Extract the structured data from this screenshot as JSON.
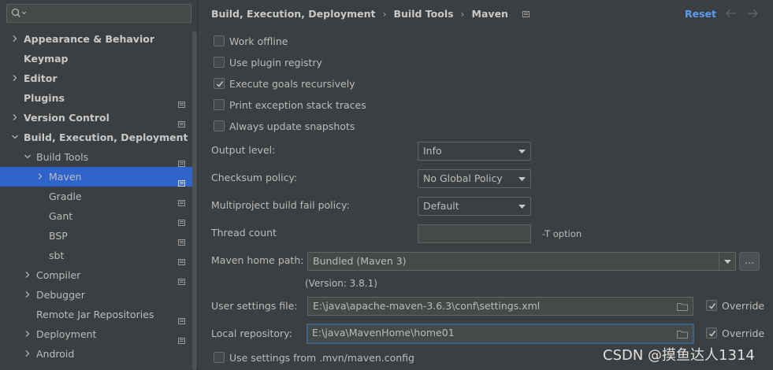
{
  "search": {
    "placeholder": ""
  },
  "sidebar": {
    "items": [
      {
        "label": "Appearance & Behavior",
        "bold": true,
        "chevron": "right",
        "project_icon": false
      },
      {
        "label": "Keymap",
        "bold": true,
        "chevron": "none",
        "project_icon": false
      },
      {
        "label": "Editor",
        "bold": true,
        "chevron": "right",
        "project_icon": false
      },
      {
        "label": "Plugins",
        "bold": true,
        "chevron": "none",
        "project_icon": true
      },
      {
        "label": "Version Control",
        "bold": true,
        "chevron": "right",
        "project_icon": true
      },
      {
        "label": "Build, Execution, Deployment",
        "bold": true,
        "chevron": "down",
        "project_icon": false
      },
      {
        "label": "Build Tools",
        "bold": false,
        "chevron": "down",
        "project_icon": true
      },
      {
        "label": "Maven",
        "bold": false,
        "chevron": "right",
        "project_icon": true,
        "selected": true
      },
      {
        "label": "Gradle",
        "bold": false,
        "chevron": "none",
        "project_icon": true
      },
      {
        "label": "Gant",
        "bold": false,
        "chevron": "none",
        "project_icon": true
      },
      {
        "label": "BSP",
        "bold": false,
        "chevron": "none",
        "project_icon": true
      },
      {
        "label": "sbt",
        "bold": false,
        "chevron": "none",
        "project_icon": true
      },
      {
        "label": "Compiler",
        "bold": false,
        "chevron": "right",
        "project_icon": true
      },
      {
        "label": "Debugger",
        "bold": false,
        "chevron": "right",
        "project_icon": false
      },
      {
        "label": "Remote Jar Repositories",
        "bold": false,
        "chevron": "none",
        "project_icon": true
      },
      {
        "label": "Deployment",
        "bold": false,
        "chevron": "right",
        "project_icon": true
      },
      {
        "label": "Android",
        "bold": false,
        "chevron": "right",
        "project_icon": false
      }
    ]
  },
  "header": {
    "breadcrumb": [
      "Build, Execution, Deployment",
      "Build Tools",
      "Maven"
    ],
    "separator": "›",
    "reset_label": "Reset"
  },
  "checkboxes": [
    {
      "label": "Work offline",
      "checked": false
    },
    {
      "label": "Use plugin registry",
      "checked": false
    },
    {
      "label": "Execute goals recursively",
      "checked": true
    },
    {
      "label": "Print exception stack traces",
      "checked": false
    },
    {
      "label": "Always update snapshots",
      "checked": false
    }
  ],
  "form": {
    "output_level": {
      "label": "Output level:",
      "value": "Info"
    },
    "checksum_policy": {
      "label": "Checksum policy:",
      "value": "No Global Policy"
    },
    "fail_policy": {
      "label": "Multiproject build fail policy:",
      "value": "Default"
    },
    "thread_count": {
      "label": "Thread count",
      "value": "",
      "hint": "-T option"
    },
    "maven_home": {
      "label": "Maven home path:",
      "value": "Bundled (Maven 3)",
      "browse_label": "...",
      "version": "(Version: 3.8.1)"
    },
    "user_settings": {
      "label": "User settings file:",
      "value": "E:\\java\\apache-maven-3.6.3\\conf\\settings.xml",
      "override_label": "Override",
      "override_checked": true
    },
    "local_repo": {
      "label": "Local repository:",
      "value": "E:\\java\\MavenHome\\home01",
      "override_label": "Override",
      "override_checked": true
    },
    "mvn_config": {
      "label": "Use settings from .mvn/maven.config",
      "checked": false
    }
  },
  "watermark": "CSDN @摸鱼达人1314",
  "colors": {
    "background": "#3c3f41",
    "selection": "#2f65ca",
    "link": "#589df6",
    "text": "#bbbbbb",
    "focus_border": "#3d6185"
  }
}
